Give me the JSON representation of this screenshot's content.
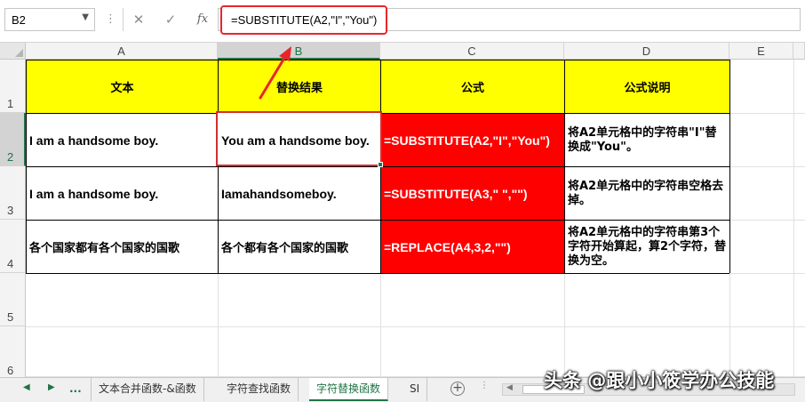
{
  "formula_bar": {
    "name_box": "B2",
    "cancel_icon": "✕",
    "enter_icon": "✓",
    "fx_label": "fx",
    "formula": "=SUBSTITUTE(A2,\"I\",\"You\")"
  },
  "columns": [
    "A",
    "B",
    "C",
    "D",
    "E"
  ],
  "rows": [
    "1",
    "2",
    "3",
    "4",
    "5",
    "6"
  ],
  "table": {
    "headers": [
      "文本",
      "替换结果",
      "公式",
      "公式说明"
    ],
    "rows": [
      [
        "I am a handsome boy.",
        "You am a handsome boy.",
        "=SUBSTITUTE(A2,\"I\",\"You\")",
        "将A2单元格中的字符串\"I\"替换成\"You\"。"
      ],
      [
        "I am a handsome boy.",
        "Iamahandsomeboy.",
        "=SUBSTITUTE(A3,\" \",\"\")",
        "将A2单元格中的字符串空格去掉。"
      ],
      [
        "各个国家都有各个国家的国歌",
        "各个都有各个国家的国歌",
        "=REPLACE(A4,3,2,\"\")",
        "将A2单元格中的字符串第3个字符开始算起，算2个字符，替换为空。"
      ]
    ]
  },
  "sheet_tabs": {
    "ellipsis": "...",
    "tabs": [
      "文本合并函数-&函数",
      "字符查找函数",
      "字符替换函数",
      "SI"
    ],
    "active_index": 2
  },
  "watermark": "头条 @跟小小筱学办公技能",
  "colors": {
    "header_fill": "#ffff00",
    "formula_fill": "#ff0000",
    "annotation": "#e8262c",
    "excel_green": "#217346"
  }
}
